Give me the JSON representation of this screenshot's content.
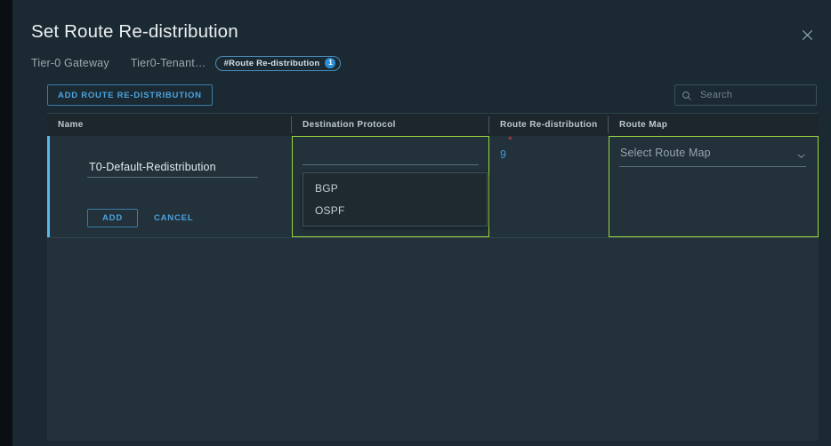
{
  "dialog": {
    "title": "Set Route Re-distribution",
    "close_icon": "close-icon"
  },
  "breadcrumb": {
    "items": [
      {
        "label": "Tier-0 Gateway"
      },
      {
        "label": "Tier0-Tenant…"
      }
    ],
    "tag": {
      "label": "#Route Re-distribution",
      "count": "1"
    }
  },
  "toolbar": {
    "add_button_label": "ADD ROUTE RE-DISTRIBUTION",
    "search": {
      "placeholder": "Search",
      "value": "",
      "icon": "search-icon"
    }
  },
  "grid": {
    "columns": [
      {
        "key": "name",
        "label": "Name"
      },
      {
        "key": "destination_protocol",
        "label": "Destination Protocol"
      },
      {
        "key": "route_redistribution",
        "label": "Route Re-distribution"
      },
      {
        "key": "route_map",
        "label": "Route Map"
      }
    ],
    "row": {
      "name_value": "T0-Default-Redistribution",
      "destination_protocol_value": "",
      "route_redistribution_value": "9",
      "required_marker": "*",
      "route_map_placeholder": "Select Route Map",
      "actions": {
        "add_label": "ADD",
        "cancel_label": "CANCEL"
      }
    },
    "protocol_dropdown": {
      "options": [
        {
          "label": "BGP"
        },
        {
          "label": "OSPF"
        }
      ]
    }
  },
  "colors": {
    "panel_bg": "#1b2a32",
    "grid_body_bg": "#22313a",
    "header_bg": "#1d262d",
    "accent_blue": "#4ca3e0",
    "row_accent": "#5bb8e8",
    "highlight_green": "#9bd93c",
    "required_red": "#e8453c",
    "value_blue": "#3f9ad8"
  }
}
